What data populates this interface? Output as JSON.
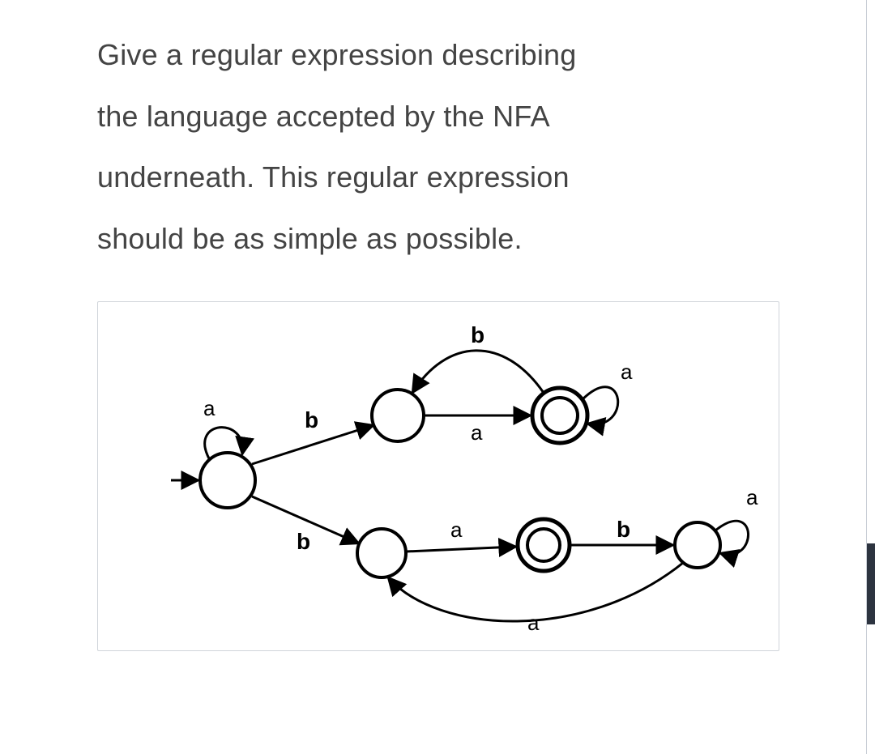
{
  "question": {
    "line1": "Give a regular expression describing",
    "line2": "the language accepted by the NFA",
    "line3": "underneath. This regular expression",
    "line4": "should be as simple as possible."
  },
  "nfa": {
    "alphabet": [
      "a",
      "b"
    ],
    "states": [
      "q0",
      "q1",
      "q2",
      "q3",
      "q4",
      "q5"
    ],
    "start": "q0",
    "accepting": [
      "q2",
      "q4"
    ],
    "transitions": [
      {
        "from": "q0",
        "to": "q0",
        "label": "a",
        "kind": "self"
      },
      {
        "from": "q0",
        "to": "q1",
        "label": "b",
        "kind": "edge"
      },
      {
        "from": "q0",
        "to": "q3",
        "label": "b",
        "kind": "edge"
      },
      {
        "from": "q1",
        "to": "q2",
        "label": "a",
        "kind": "edge"
      },
      {
        "from": "q2",
        "to": "q1",
        "label": "b",
        "kind": "edge"
      },
      {
        "from": "q2",
        "to": "q2",
        "label": "a",
        "kind": "self"
      },
      {
        "from": "q3",
        "to": "q4",
        "label": "a",
        "kind": "edge"
      },
      {
        "from": "q4",
        "to": "q5",
        "label": "b",
        "kind": "edge"
      },
      {
        "from": "q5",
        "to": "q5",
        "label": "a",
        "kind": "self"
      },
      {
        "from": "q5",
        "to": "q3",
        "label": "a",
        "kind": "edge"
      }
    ],
    "labels": {
      "q0_self": "a",
      "q0_q1": "b",
      "q0_q3": "b",
      "q1_q2": "a",
      "q2_q1": "b",
      "q2_self": "a",
      "q3_q4": "a",
      "q4_q5": "b",
      "q5_self": "a",
      "q5_q3": "a"
    }
  }
}
